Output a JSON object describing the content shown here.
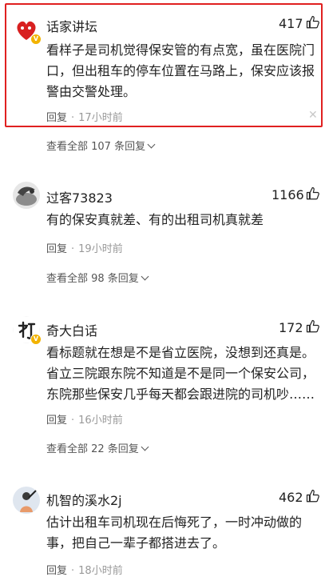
{
  "comments": [
    {
      "username": "话家讲坛",
      "likes": "417",
      "text": "看样子是司机觉得保安管的有点宽，虽在医院门口，但出租车的停车位置在马路上，保安应该报警由交警处理。",
      "reply_label": "回复",
      "time": "17小时前",
      "view_all": "查看全部 107 条回复",
      "avatar_badge": "V",
      "close_glyph": "✕"
    },
    {
      "username": "过客73823",
      "likes": "1166",
      "text": "有的保安真就差、有的出租司机真就差",
      "reply_label": "回复",
      "time": "19小时前",
      "view_all": "查看全部 98 条回复"
    },
    {
      "username": "奇大白话",
      "likes": "172",
      "text": "看标题就在想是不是省立医院，没想到还真是。省立三院跟东院不知道是不是同一个保安公司，东院那些保安几乎每天都会跟进院的司机吵……",
      "reply_label": "回复",
      "time": "16小时前",
      "view_all": "查看全部 22 条回复",
      "avatar_badge": "V"
    },
    {
      "username": "机智的溪水2j",
      "likes": "462",
      "text": "估计出租车司机现在后悔死了，一时冲动做的事，把自己一辈子都搭进去了。",
      "reply_label": "回复",
      "time": "18小时前"
    }
  ],
  "icons": {
    "like": "thumbs-up-icon",
    "close": "close-icon",
    "chevron": "chevron-down-icon"
  },
  "colors": {
    "highlight_border": "#e02020",
    "verified_badge": "#f2b300",
    "meta_text": "#999999"
  }
}
